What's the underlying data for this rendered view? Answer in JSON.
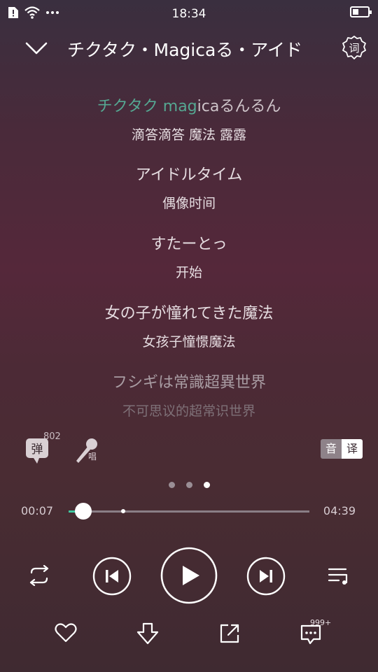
{
  "status_bar": {
    "time": "18:34",
    "battery_level": 0.5,
    "icons": [
      "sim-alert-icon",
      "wifi-icon",
      "more-dots-icon",
      "battery-icon"
    ]
  },
  "header": {
    "title": "チクタク・Magicaる・アイド",
    "collapse_icon": "chevron-down-icon",
    "settings_icon": "gear-icon",
    "settings_label": "词"
  },
  "lyrics": [
    {
      "original": "チクタク magicaるんるん",
      "translation": "滴答滴答 魔法 露露",
      "highlight_progress": 0.55
    },
    {
      "original": "アイドルタイム",
      "translation": "偶像时间"
    },
    {
      "original": "すたーとっ",
      "translation": "开始"
    },
    {
      "original": "女の子が憧れてきた魔法",
      "translation": "女孩子憧憬魔法"
    },
    {
      "original": "フシギは常識超異世界",
      "translation": "不可思议的超常识世界"
    }
  ],
  "tools": {
    "danmaku_label": "弹",
    "danmaku_count": "802",
    "mic_label": "唱",
    "toggle_yin": "音",
    "toggle_yi": "译"
  },
  "pager": {
    "count": 3,
    "active_index": 2
  },
  "progress": {
    "current": "00:07",
    "total": "04:39",
    "played_fraction": 0.061,
    "buffered_fraction": 0.227
  },
  "controls": {
    "repeat_icon": "repeat-icon",
    "prev_icon": "previous-icon",
    "play_icon": "play-icon",
    "next_icon": "next-icon",
    "playlist_icon": "playlist-icon"
  },
  "bottom": {
    "like_icon": "heart-icon",
    "download_icon": "download-icon",
    "share_icon": "share-icon",
    "comment_icon": "comment-icon",
    "comment_count": "999+"
  },
  "colors": {
    "accent": "#3fc8a0",
    "text_dim": "#d7ccd1"
  }
}
